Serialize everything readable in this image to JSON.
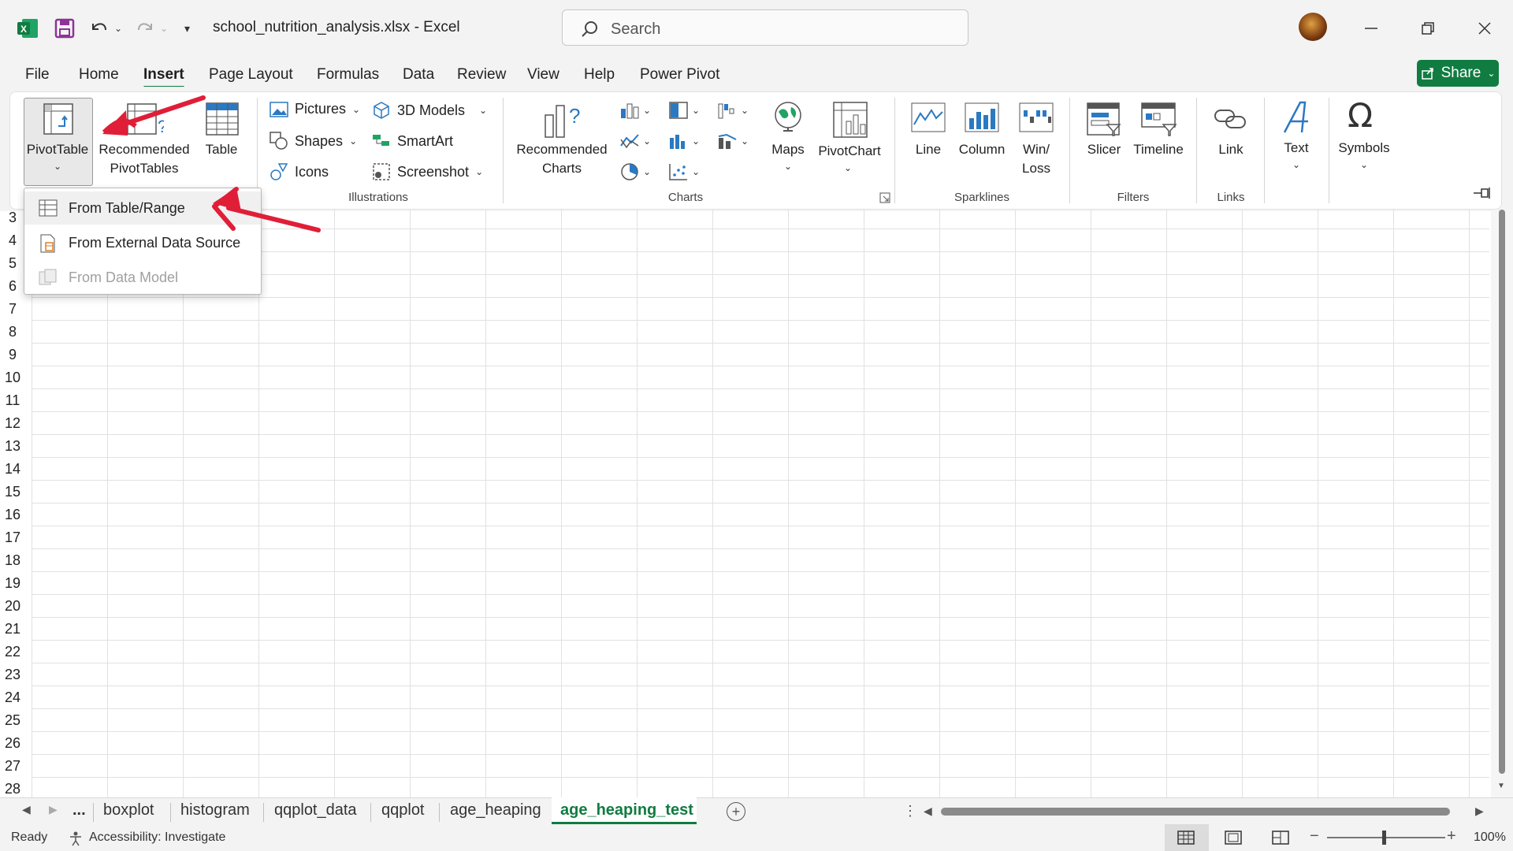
{
  "titlebar": {
    "document_title": "school_nutrition_analysis.xlsx  -  Excel",
    "search_placeholder": "Search"
  },
  "menu": {
    "items": [
      "File",
      "Home",
      "Insert",
      "Page Layout",
      "Formulas",
      "Data",
      "Review",
      "View",
      "Help",
      "Power Pivot"
    ],
    "active": "Insert",
    "share_label": "Share"
  },
  "ribbon": {
    "tables": {
      "pivottable": "PivotTable",
      "recommended_pivottables_1": "Recommended",
      "recommended_pivottables_2": "PivotTables",
      "table": "Table"
    },
    "illustrations": {
      "group_label": "Illustrations",
      "pictures": "Pictures",
      "shapes": "Shapes",
      "icons": "Icons",
      "models_3d": "3D Models",
      "smartart": "SmartArt",
      "screenshot": "Screenshot"
    },
    "charts": {
      "group_label": "Charts",
      "recommended_1": "Recommended",
      "recommended_2": "Charts",
      "maps": "Maps",
      "pivotchart": "PivotChart"
    },
    "sparklines": {
      "group_label": "Sparklines",
      "line": "Line",
      "column": "Column",
      "winloss_1": "Win/",
      "winloss_2": "Loss"
    },
    "filters": {
      "group_label": "Filters",
      "slicer": "Slicer",
      "timeline": "Timeline"
    },
    "links": {
      "group_label": "Links",
      "link": "Link"
    },
    "text": {
      "label": "Text"
    },
    "symbols": {
      "label": "Symbols"
    }
  },
  "pivot_dropdown": {
    "items": [
      {
        "label": "From Table/Range",
        "enabled": true
      },
      {
        "label": "From External Data Source",
        "enabled": true
      },
      {
        "label": "From Data Model",
        "enabled": false
      }
    ]
  },
  "grid": {
    "row_numbers": [
      "3",
      "4",
      "5",
      "6",
      "7",
      "8",
      "9",
      "10",
      "11",
      "12",
      "13",
      "14",
      "15",
      "16",
      "17",
      "18",
      "19",
      "20",
      "21",
      "22",
      "23",
      "24",
      "25",
      "26",
      "27",
      "28"
    ]
  },
  "sheets": {
    "ellipsis": "...",
    "tabs": [
      "boxplot",
      "histogram",
      "qqplot_data",
      "qqplot",
      "age_heaping",
      "age_heaping_test"
    ],
    "active": "age_heaping_test"
  },
  "status": {
    "ready": "Ready",
    "accessibility": "Accessibility: Investigate",
    "zoom": "100%"
  },
  "colors": {
    "accent": "#107c41",
    "annotation_arrow": "#e01e37"
  }
}
